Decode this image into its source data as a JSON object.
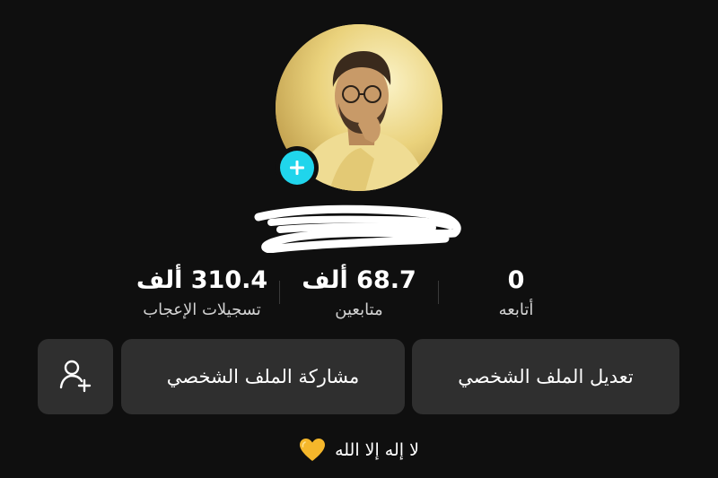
{
  "profile": {
    "username_redacted": true
  },
  "stats": {
    "following": {
      "value": "0",
      "label": "أتابعه"
    },
    "followers": {
      "value": "68.7 ألف",
      "label": "متابعين"
    },
    "likes": {
      "value": "310.4 ألف",
      "label": "تسجيلات الإعجاب"
    }
  },
  "buttons": {
    "edit_profile": "تعديل الملف الشخصي",
    "share_profile": "مشاركة الملف الشخصي",
    "add_friend_icon": "person-add-icon"
  },
  "bio": {
    "text": "لا إله إلا الله",
    "emoji_icon": "yellow-heart-icon"
  },
  "colors": {
    "background": "#0f0f0f",
    "button_bg": "#2f2f2f",
    "add_badge": "#20d5ec",
    "heart": "#f5b72b"
  }
}
